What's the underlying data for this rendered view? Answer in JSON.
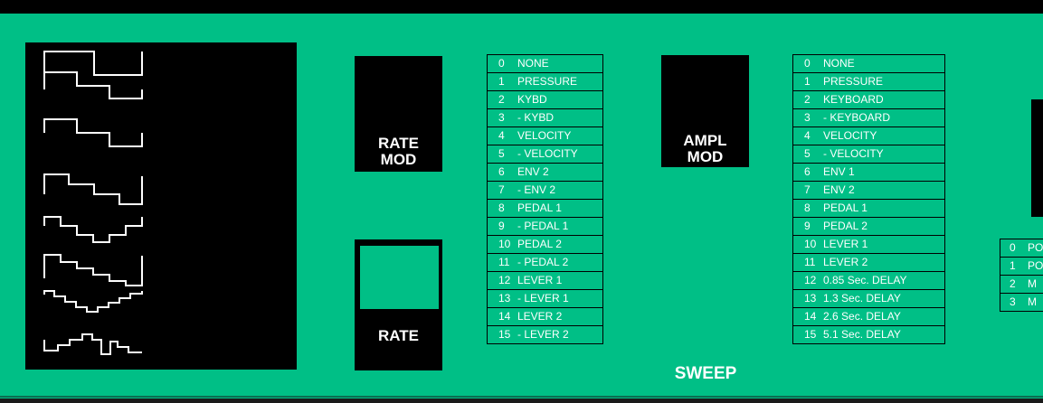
{
  "waveforms": [
    {
      "name": "square"
    },
    {
      "name": "step-down-2"
    },
    {
      "name": "step-down-up"
    },
    {
      "name": "stair-down-3"
    },
    {
      "name": "stair-down-up"
    },
    {
      "name": "stair-down-4"
    },
    {
      "name": "stair-down-up-fine"
    },
    {
      "name": "random-steps"
    }
  ],
  "rate_mod": {
    "label": "RATE\nMOD"
  },
  "rate": {
    "label": "RATE"
  },
  "ampl_mod": {
    "label": "AMPL\nMOD"
  },
  "sweep_label": "SWEEP",
  "rate_mod_list": [
    {
      "num": "0",
      "label": "NONE"
    },
    {
      "num": "1",
      "label": "PRESSURE"
    },
    {
      "num": "2",
      "label": "KYBD"
    },
    {
      "num": "3",
      "label": "- KYBD"
    },
    {
      "num": "4",
      "label": "VELOCITY"
    },
    {
      "num": "5",
      "label": "- VELOCITY"
    },
    {
      "num": "6",
      "label": "ENV 2"
    },
    {
      "num": "7",
      "label": "- ENV 2"
    },
    {
      "num": "8",
      "label": "PEDAL 1"
    },
    {
      "num": "9",
      "label": "- PEDAL 1"
    },
    {
      "num": "10",
      "label": "PEDAL 2"
    },
    {
      "num": "11",
      "label": "- PEDAL 2"
    },
    {
      "num": "12",
      "label": "LEVER 1"
    },
    {
      "num": "13",
      "label": "- LEVER 1"
    },
    {
      "num": "14",
      "label": "LEVER 2"
    },
    {
      "num": "15",
      "label": "- LEVER 2"
    }
  ],
  "ampl_mod_list": [
    {
      "num": "0",
      "label": "NONE"
    },
    {
      "num": "1",
      "label": "PRESSURE"
    },
    {
      "num": "2",
      "label": "KEYBOARD"
    },
    {
      "num": "3",
      "label": "- KEYBOARD"
    },
    {
      "num": "4",
      "label": "VELOCITY"
    },
    {
      "num": "5",
      "label": "- VELOCITY"
    },
    {
      "num": "6",
      "label": "ENV 1"
    },
    {
      "num": "7",
      "label": "ENV 2"
    },
    {
      "num": "8",
      "label": "PEDAL 1"
    },
    {
      "num": "9",
      "label": "PEDAL 2"
    },
    {
      "num": "10",
      "label": "LEVER 1"
    },
    {
      "num": "11",
      "label": "LEVER 2"
    },
    {
      "num": "12",
      "label": "0.85 Sec. DELAY"
    },
    {
      "num": "13",
      "label": "1.3 Sec. DELAY"
    },
    {
      "num": "14",
      "label": "2.6 Sec. DELAY"
    },
    {
      "num": "15",
      "label": "5.1 Sec. DELAY"
    }
  ],
  "right_list": [
    {
      "num": "0",
      "label": "PO"
    },
    {
      "num": "1",
      "label": "PO"
    },
    {
      "num": "2",
      "label": "M"
    },
    {
      "num": "3",
      "label": "M"
    }
  ]
}
